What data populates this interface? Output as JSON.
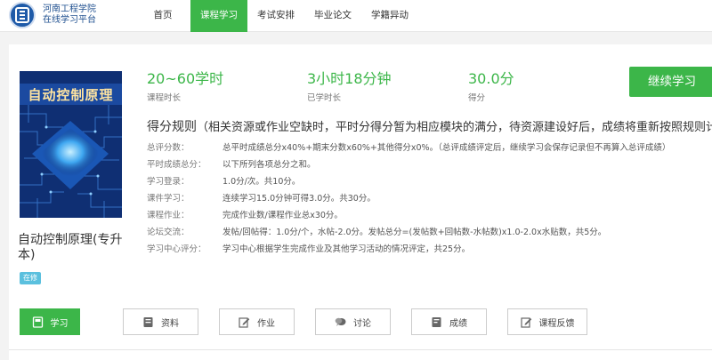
{
  "header": {
    "logo_line1": "河南工程学院",
    "logo_line2": "在线学习平台",
    "nav": [
      "首页",
      "课程学习",
      "考试安排",
      "毕业论文",
      "学籍异动"
    ],
    "active_nav": 1
  },
  "course": {
    "cover_title": "自动控制原理",
    "name": "自动控制原理(专升本)",
    "badge": "在修"
  },
  "stats": [
    {
      "value": "20~60学时",
      "label": "课程时长"
    },
    {
      "value": "3小时18分钟",
      "label": "已学时长"
    },
    {
      "value": "30.0分",
      "label": "得分"
    }
  ],
  "continue_label": "继续学习",
  "rules": {
    "title": "得分规则",
    "note": "（相关资源或作业空缺时，平时分得分暂为相应模块的满分，待资源建设好后，成绩将重新按照规则计算",
    "rows": [
      {
        "label": "总评分数：",
        "text": "总平时成绩总分x40%+期末分数x60%+其他得分x0%。（总评成绩评定后，继续学习会保存记录但不再算入总评成绩）"
      },
      {
        "label": "平时成绩总分：",
        "text": "以下所列各项总分之和。"
      },
      {
        "label": "学习登录：",
        "text": "1.0分/次。共10分。"
      },
      {
        "label": "课件学习：",
        "text": "连续学习15.0分钟可得3.0分。共30分。"
      },
      {
        "label": "课程作业：",
        "text": "完成作业数/课程作业总x30分。"
      },
      {
        "label": "论坛交流：",
        "text": "发帖/回帖得：1.0分/个，水帖-2.0分。发帖总分=(发帖数+回帖数-水帖数)x1.0-2.0x水贴数，共5分。"
      },
      {
        "label": "学习中心评分：",
        "text": "学习中心根据学生完成作业及其他学习活动的情况评定，共25分。"
      }
    ]
  },
  "actions": [
    {
      "label": "学习",
      "icon": "book-icon"
    },
    {
      "label": "资料",
      "icon": "document-icon"
    },
    {
      "label": "作业",
      "icon": "edit-icon"
    },
    {
      "label": "讨论",
      "icon": "chat-icon"
    },
    {
      "label": "成绩",
      "icon": "report-icon"
    },
    {
      "label": "课程反馈",
      "icon": "feedback-edit-icon"
    }
  ],
  "colors": {
    "accent": "#3cb649",
    "badge": "#5bc0de",
    "logo": "#1e5aa8"
  }
}
